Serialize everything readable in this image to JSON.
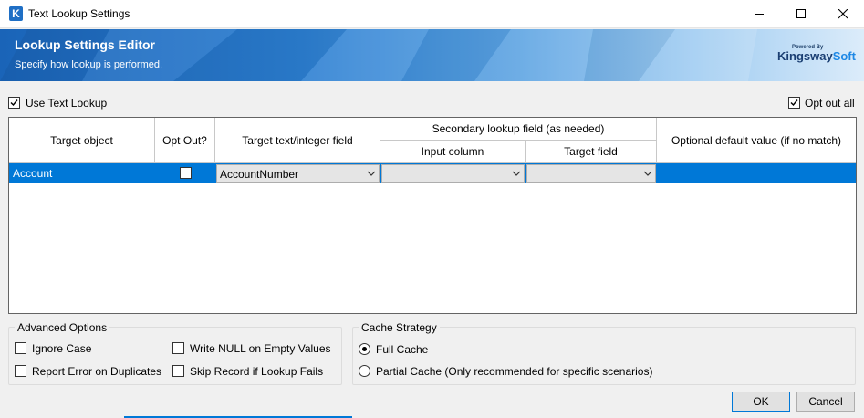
{
  "window": {
    "title": "Text Lookup Settings",
    "app_icon_letter": "K"
  },
  "banner": {
    "title": "Lookup Settings Editor",
    "subtitle": "Specify how lookup is performed.",
    "logo_powered": "Powered By",
    "logo_main": "Kingsway",
    "logo_accent": "Soft"
  },
  "options": {
    "use_text_lookup": "Use Text Lookup",
    "opt_out_all": "Opt out all"
  },
  "grid": {
    "headers": {
      "target_object": "Target object",
      "opt_out": "Opt Out?",
      "target_field": "Target text/integer field",
      "secondary": "Secondary lookup field (as needed)",
      "input_column": "Input column",
      "target_field2": "Target field",
      "default_value": "Optional default value (if no match)"
    },
    "rows": [
      {
        "target_object": "Account",
        "target_field": "AccountNumber",
        "input_column": "",
        "target_field2": "",
        "default_value": ""
      }
    ]
  },
  "advanced": {
    "title": "Advanced Options",
    "ignore_case": "Ignore Case",
    "report_error": "Report Error on Duplicates",
    "write_null": "Write NULL on Empty Values",
    "skip_record": "Skip Record if Lookup Fails"
  },
  "cache": {
    "title": "Cache Strategy",
    "full": "Full Cache",
    "partial": "Partial Cache (Only recommended for specific scenarios)"
  },
  "buttons": {
    "ok": "OK",
    "cancel": "Cancel"
  },
  "colors": {
    "accent": "#0078d7",
    "banner_start": "#1a64b8",
    "banner_end": "#dcecfa"
  }
}
